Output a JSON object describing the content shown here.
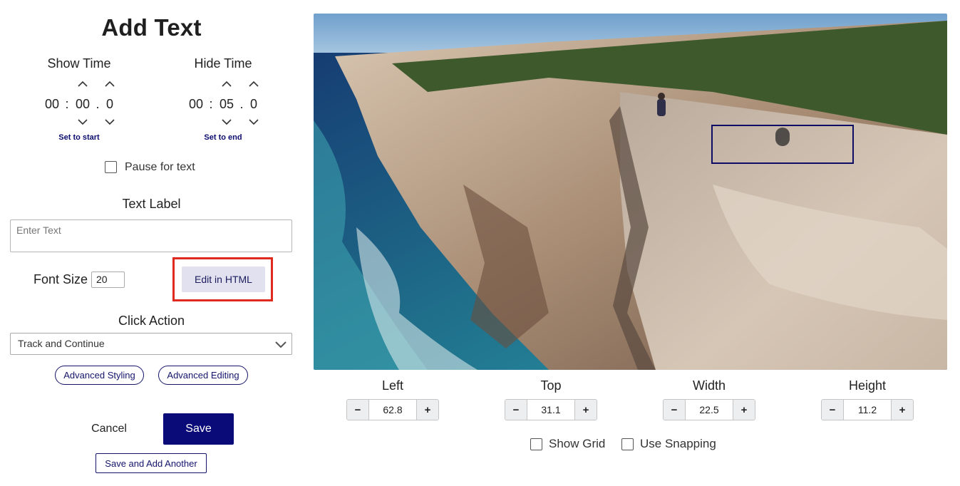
{
  "panel": {
    "title": "Add Text",
    "show_time": {
      "heading": "Show Time",
      "hours": "00",
      "minutes": "00",
      "tenths": "0",
      "link": "Set to start"
    },
    "hide_time": {
      "heading": "Hide Time",
      "hours": "00",
      "minutes": "05",
      "tenths": "0",
      "link": "Set to end"
    },
    "time_separator": ":",
    "decimal_separator": ".",
    "pause_label": "Pause for text",
    "text_label_heading": "Text Label",
    "text_placeholder": "Enter Text",
    "font_size_label": "Font Size",
    "font_size_value": "20",
    "edit_html_label": "Edit in HTML",
    "click_action_heading": "Click Action",
    "click_action_value": "Track and Continue",
    "advanced_styling_label": "Advanced Styling",
    "advanced_editing_label": "Advanced Editing",
    "cancel_label": "Cancel",
    "save_label": "Save",
    "save_another_label": "Save and Add Another"
  },
  "position": {
    "left": {
      "label": "Left",
      "value": "62.8"
    },
    "top": {
      "label": "Top",
      "value": "31.1"
    },
    "width": {
      "label": "Width",
      "value": "22.5"
    },
    "height": {
      "label": "Height",
      "value": "11.2"
    },
    "minus": "−",
    "plus": "+"
  },
  "grid": {
    "show_grid_label": "Show Grid",
    "use_snapping_label": "Use Snapping"
  },
  "colors": {
    "primary": "#0a0a78",
    "highlight": "#e02a20",
    "link": "#0c0c6e"
  }
}
